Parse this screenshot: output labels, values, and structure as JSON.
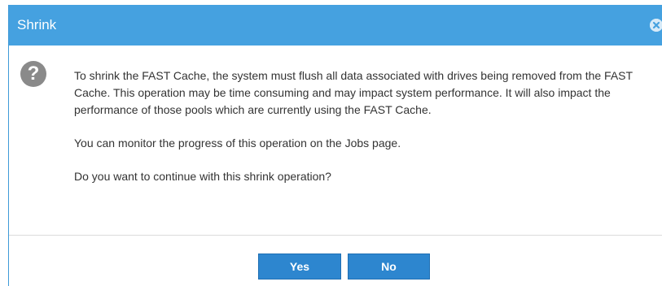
{
  "dialog": {
    "title": "Shrink",
    "icons": {
      "close": "close-circle-icon",
      "question": "question-circle-icon"
    },
    "question_glyph": "?",
    "message": {
      "paragraph1": "To shrink the FAST Cache, the system must flush all data associated with drives being removed from the FAST Cache. This operation may be time consuming and may impact system performance. It will also impact the performance of those pools which are currently using the FAST Cache.",
      "paragraph2": "You can monitor the progress of this operation on the Jobs page.",
      "paragraph3": "Do you want to continue with this shrink operation?"
    },
    "buttons": {
      "yes_label": "Yes",
      "no_label": "No"
    }
  },
  "colors": {
    "titlebar": "#45a1e0",
    "button": "#2d86cf",
    "icon_gray": "#8a8a8a"
  }
}
